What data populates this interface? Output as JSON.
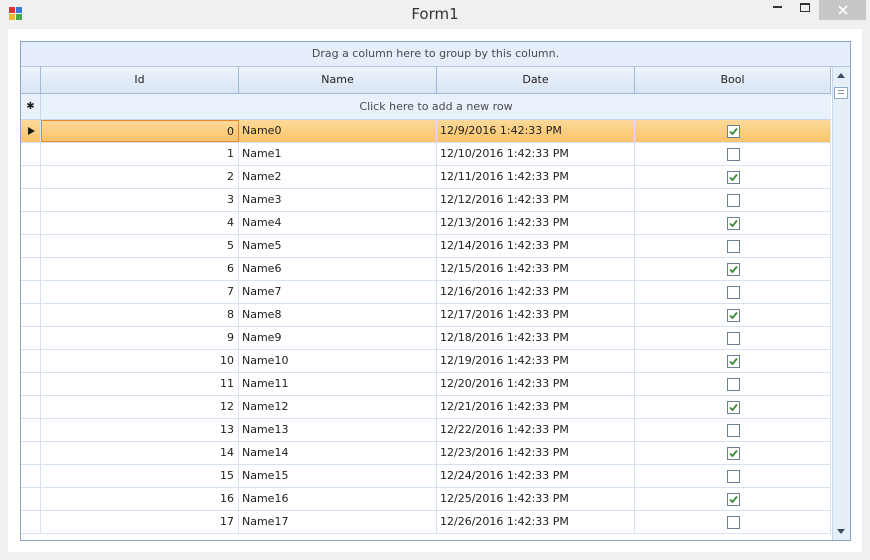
{
  "window": {
    "title": "Form1"
  },
  "grid": {
    "group_panel_text": "Drag a column here to group by this column.",
    "new_row_text": "Click here to add a new row",
    "columns": [
      "Id",
      "Name",
      "Date",
      "Bool"
    ],
    "rows": [
      {
        "id": "0",
        "name": "Name0",
        "date": "12/9/2016 1:42:33 PM",
        "bool": true,
        "selected": true
      },
      {
        "id": "1",
        "name": "Name1",
        "date": "12/10/2016 1:42:33 PM",
        "bool": false
      },
      {
        "id": "2",
        "name": "Name2",
        "date": "12/11/2016 1:42:33 PM",
        "bool": true
      },
      {
        "id": "3",
        "name": "Name3",
        "date": "12/12/2016 1:42:33 PM",
        "bool": false
      },
      {
        "id": "4",
        "name": "Name4",
        "date": "12/13/2016 1:42:33 PM",
        "bool": true
      },
      {
        "id": "5",
        "name": "Name5",
        "date": "12/14/2016 1:42:33 PM",
        "bool": false
      },
      {
        "id": "6",
        "name": "Name6",
        "date": "12/15/2016 1:42:33 PM",
        "bool": true
      },
      {
        "id": "7",
        "name": "Name7",
        "date": "12/16/2016 1:42:33 PM",
        "bool": false
      },
      {
        "id": "8",
        "name": "Name8",
        "date": "12/17/2016 1:42:33 PM",
        "bool": true
      },
      {
        "id": "9",
        "name": "Name9",
        "date": "12/18/2016 1:42:33 PM",
        "bool": false
      },
      {
        "id": "10",
        "name": "Name10",
        "date": "12/19/2016 1:42:33 PM",
        "bool": true
      },
      {
        "id": "11",
        "name": "Name11",
        "date": "12/20/2016 1:42:33 PM",
        "bool": false
      },
      {
        "id": "12",
        "name": "Name12",
        "date": "12/21/2016 1:42:33 PM",
        "bool": true
      },
      {
        "id": "13",
        "name": "Name13",
        "date": "12/22/2016 1:42:33 PM",
        "bool": false
      },
      {
        "id": "14",
        "name": "Name14",
        "date": "12/23/2016 1:42:33 PM",
        "bool": true
      },
      {
        "id": "15",
        "name": "Name15",
        "date": "12/24/2016 1:42:33 PM",
        "bool": false
      },
      {
        "id": "16",
        "name": "Name16",
        "date": "12/25/2016 1:42:33 PM",
        "bool": true
      },
      {
        "id": "17",
        "name": "Name17",
        "date": "12/26/2016 1:42:33 PM",
        "bool": false
      }
    ]
  },
  "colors": {
    "selected_row": "#f9c46a",
    "header": "#dde8f6",
    "checkmark": "#3a8a3a"
  }
}
